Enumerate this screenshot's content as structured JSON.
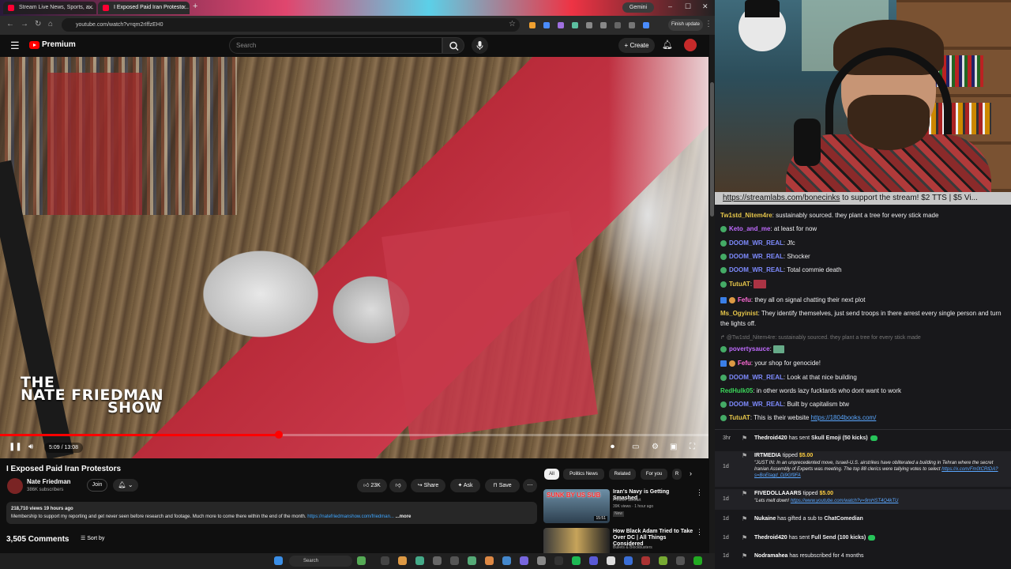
{
  "browser": {
    "tabs": [
      {
        "label": "Stream Live News, Sports, a..."
      },
      {
        "label": "I Exposed Paid Iran Protesto..."
      }
    ],
    "gemini_label": "Gemini",
    "url": "youtube.com/watch?v=qm2rIffzEH0",
    "finish_update": "Finish update"
  },
  "youtube": {
    "logo_text": "Premium",
    "search_placeholder": "Search",
    "create_label": "Create"
  },
  "video": {
    "overlay_line1": "THE",
    "overlay_line2": "NATE FRIEDMAN",
    "overlay_line3": "SHOW",
    "time": "5:09 / 13:08",
    "progress": 0.394
  },
  "details": {
    "title": "I Exposed Paid Iran Protestors",
    "channel": "Nate Friedman",
    "subscribers": "386K subscribers",
    "join": "Join",
    "likes": "23K",
    "share": "Share",
    "ask": "Ask",
    "save": "Save",
    "stats": "218,710 views  19 hours ago",
    "description": "Membership to support my reporting and get never seen before research and footage. Much more to come there within the end of the month.",
    "desc_link": "https://natefriedmanshow.com/friedman...",
    "more": "...more",
    "comments": "3,505 Comments",
    "sort": "Sort by"
  },
  "recommendations": {
    "chips": [
      "All",
      "Politics News",
      "Related",
      "For you",
      "R"
    ],
    "items": [
      {
        "title": "Iran's Navy is Getting Smashed",
        "channel": "Preston Stewart",
        "meta": "39K views · 1 hour ago",
        "badge": "New",
        "thumb_text": "SUNK BY US SUB",
        "duration": "15:51"
      },
      {
        "title": "How Black Adam Tried to Take Over DC | All Things Considered",
        "channel": "Bullets & Blockbusters",
        "meta": "",
        "badge": "",
        "thumb_text": "",
        "duration": ""
      }
    ]
  },
  "taskbar": {
    "search": "Search"
  },
  "chat": {
    "ticker_link": "https://streamlabs.com/bonecinks",
    "ticker_text": " to support the stream! $2 TTS | $5 Vi...",
    "messages": [
      {
        "user": "Tw1std_Nitem4re",
        "text": "sustainably sourced. they plant a tree for every stick made",
        "color": "#e5c54a"
      },
      {
        "user": "Keto_and_me",
        "text": "at least for now",
        "color": "#c06bff"
      },
      {
        "user": "DOOM_WR_REAL",
        "text": "Jfc",
        "color": "#7e8bff"
      },
      {
        "user": "DOOM_WR_REAL",
        "text": "Shocker",
        "color": "#7e8bff"
      },
      {
        "user": "DOOM_WR_REAL",
        "text": "Total commie death",
        "color": "#7e8bff"
      },
      {
        "user": "TutuAT",
        "text": "",
        "color": "#e5c54a"
      },
      {
        "user": "Fefu",
        "text": "they all on signal chatting their next plot",
        "color": "#ff6bd6"
      },
      {
        "user": "Ms_Ogyinist",
        "text": "They identify themselves, just send troops in there arrest every single person and turn the lights off.",
        "color": "#e5c54a"
      },
      {
        "reply": "@Tw1std_Nitem4re: sustainably sourced. they plant a tree for every stick made"
      },
      {
        "user": "povertysauce",
        "text": "",
        "color": "#c06bff"
      },
      {
        "user": "Fefu",
        "text": "your shop for genocide!",
        "color": "#ff6bd6"
      },
      {
        "user": "DOOM_WR_REAL",
        "text": "Look at that nice building",
        "color": "#7e8bff"
      },
      {
        "user": "RedHulk05",
        "text": "in other words lazy fucktards who dont want to work",
        "color": "#3bd65a"
      },
      {
        "user": "DOOM_WR_REAL",
        "text": "Built by capitalism btw",
        "color": "#7e8bff"
      },
      {
        "user": "TutuAT",
        "text": "This is their website ",
        "link": "https://1804books.com/",
        "color": "#e5c54a"
      }
    ],
    "events": [
      {
        "ago": "3hr",
        "name": "Thedroid420",
        "text": " has sent ",
        "item": "Skull Emoji (50 kicks)"
      },
      {
        "ago": "1d",
        "name": "IRTMEDIA",
        "text": " tipped ",
        "amount": "$5.00",
        "quote": "\"JUST IN: In an unprecedented move, Israeli-U.S. airstrikes have obliterated a building in Tehran where the secret Iranian Assembly of Experts was meeting. The top 88 clerics were tallying votes to select ",
        "quote_link": "https://x.com/Fm0tCRtDA?s=BoEtagd_Dj9Gf9FA"
      },
      {
        "ago": "1d",
        "name": "FIVEDOLLAAARS",
        "text": " tipped ",
        "amount": "$5.00",
        "quote": "\"Lets melt down! ",
        "quote_link": "https://www.youtube.com/watch?v=9mHST4Q4kTU"
      },
      {
        "ago": "1d",
        "name": "Nukaine",
        "text": " has gifted a sub to ",
        "item": "ChatComedian"
      },
      {
        "ago": "1d",
        "name": "Thedroid420",
        "text": " has sent ",
        "item": "Full Send (100 kicks)"
      },
      {
        "ago": "1d",
        "name": "Nodramahea",
        "text": " has resubscribed for 4 months"
      }
    ]
  }
}
